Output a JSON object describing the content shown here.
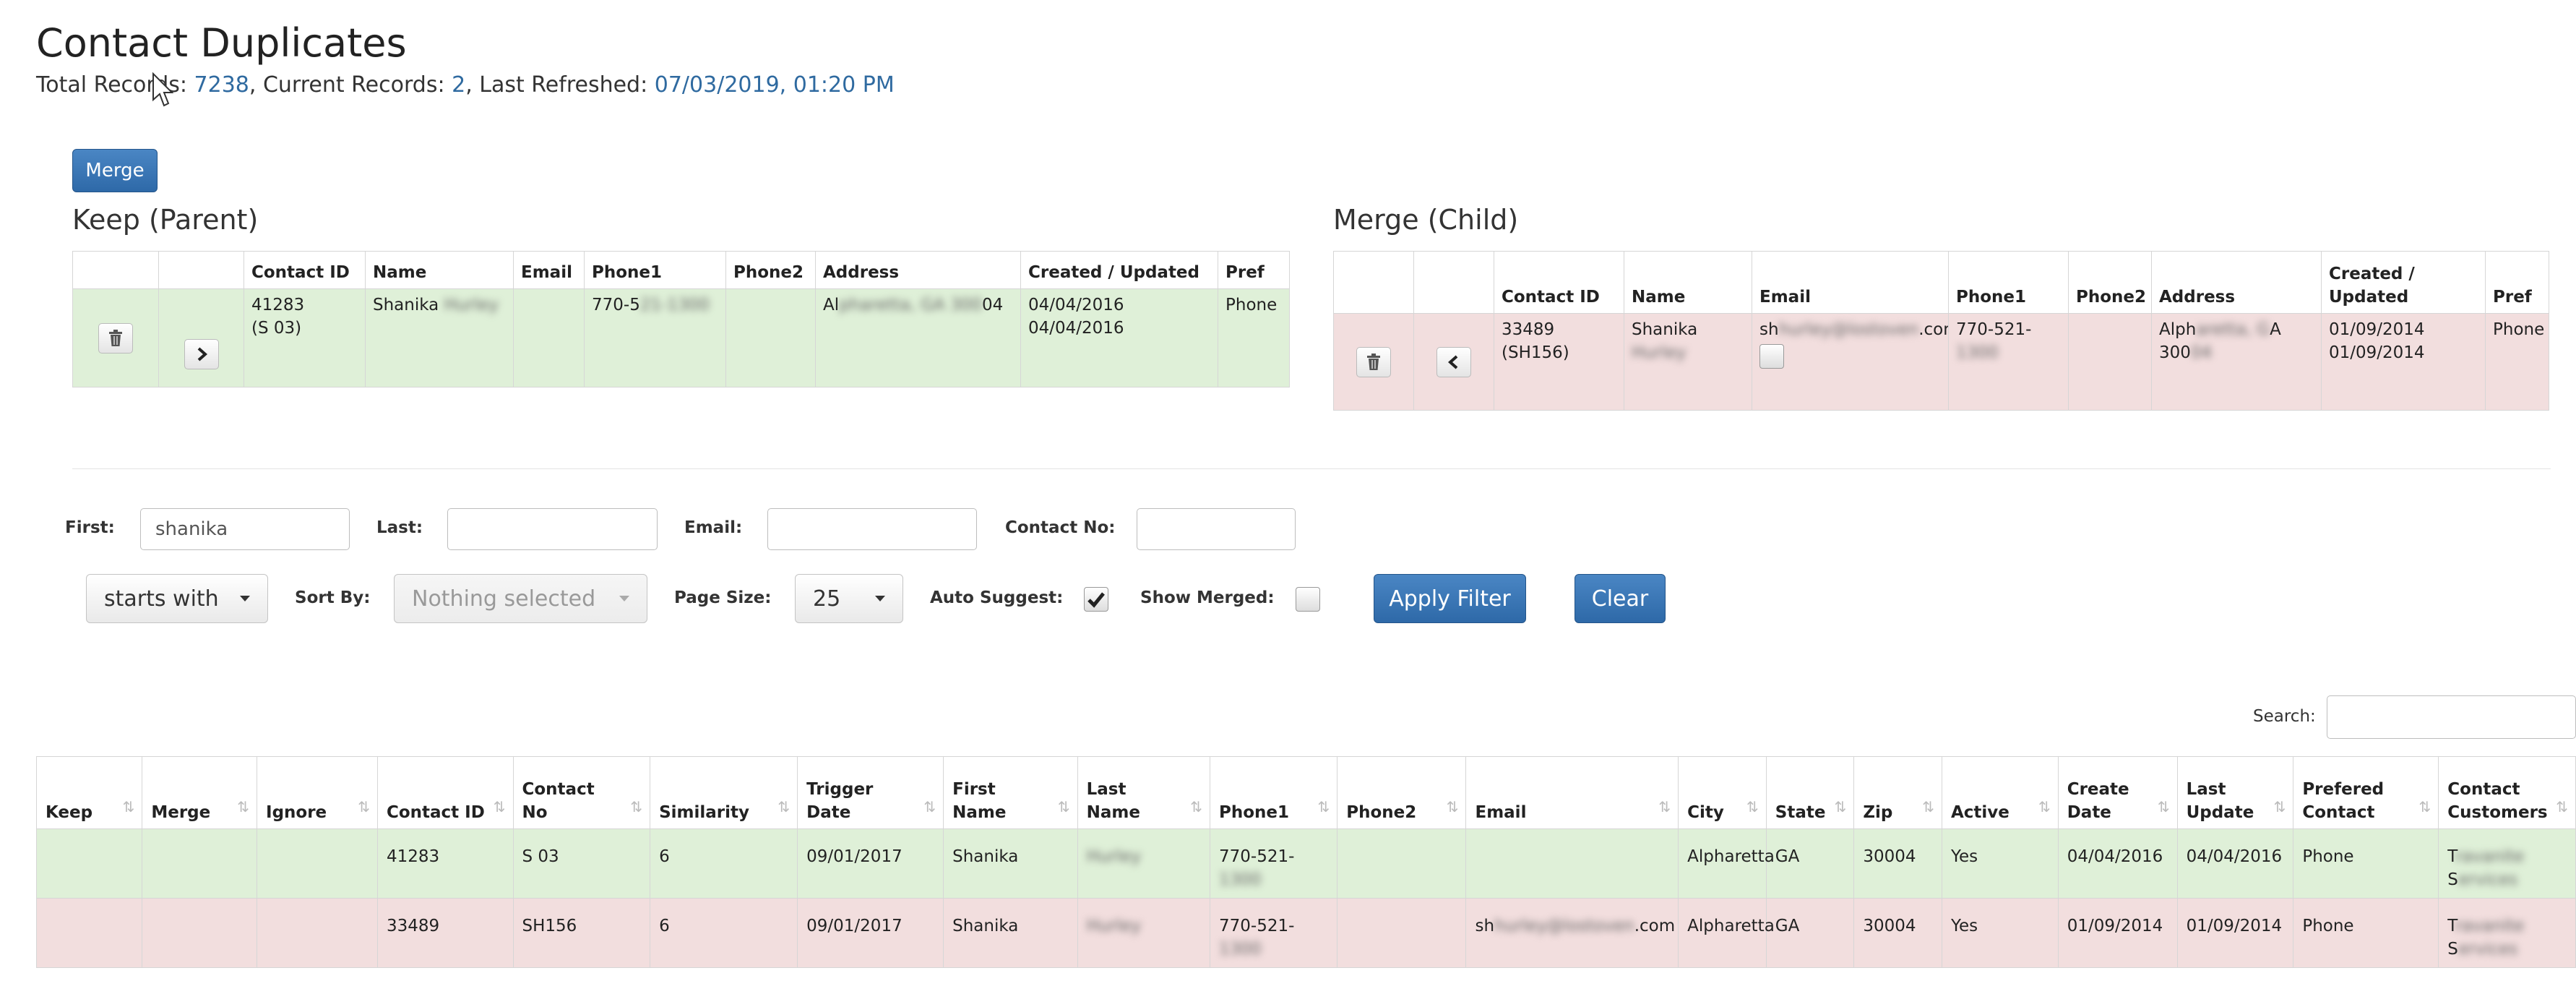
{
  "page": {
    "title": "Contact Duplicates",
    "summary": {
      "total_label": "Total Records: ",
      "total_value": "7238",
      "current_label": ", Current Records: ",
      "current_value": "2",
      "refreshed_label": ", Last Refreshed: ",
      "refreshed_value": "07/03/2019, 01:20 PM"
    }
  },
  "merge_button": "Merge",
  "keep_panel": {
    "title": "Keep (Parent)",
    "headers": [
      "",
      "",
      "Contact ID",
      "Name",
      "Email",
      "Phone1",
      "Phone2",
      "Address",
      "Created / Updated",
      "Pref"
    ],
    "row": {
      "contact_id": "41283",
      "contact_no": "(S 03)",
      "name_first": "Shanika",
      "name_last": "Hurley",
      "email": "",
      "phone1_visible": "770-5",
      "phone1_hidden": "21-1300",
      "phone2": "",
      "address_visible_a": "Al",
      "address_hidden": "pharetta, GA 300",
      "address_visible_b": "04",
      "created": "04/04/2016",
      "updated": "04/04/2016",
      "pref": "Phone"
    }
  },
  "merge_panel": {
    "title": "Merge (Child)",
    "headers": [
      "",
      "",
      "Contact ID",
      "Name",
      "Email",
      "Phone1",
      "Phone2",
      "Address",
      "Created / Updated",
      "Pref"
    ],
    "row": {
      "contact_id": "33489",
      "contact_no": "(SH156)",
      "name_first": "Shanika",
      "name_last": "Hurley",
      "email_visible_a": "sh",
      "email_hidden": "hurley@lostoven",
      "email_visible_b": ".com",
      "phone1_visible": "770-521-",
      "phone1_hidden": "1300",
      "phone2": "",
      "address_visible_a": "Alph",
      "address_hidden": "aretta, G",
      "address_visible_b": "A",
      "address_line2_visible": "300",
      "address_line2_hidden": "04",
      "created": "01/09/2014",
      "updated": "01/09/2014",
      "pref": "Phone"
    }
  },
  "filters": {
    "first_label": "First:",
    "first_value": "shanika",
    "last_label": "Last:",
    "last_value": "",
    "email_label": "Email:",
    "email_value": "",
    "contact_no_label": "Contact No:",
    "contact_no_value": "",
    "match_mode": "starts with",
    "sort_by_label": "Sort By:",
    "sort_by_value": "Nothing selected",
    "page_size_label": "Page Size:",
    "page_size_value": "25",
    "auto_suggest_label": "Auto Suggest:",
    "auto_suggest_checked": true,
    "show_merged_label": "Show Merged:",
    "show_merged_checked": false,
    "apply_label": "Apply Filter",
    "clear_label": "Clear"
  },
  "search": {
    "label": "Search:",
    "value": ""
  },
  "grid": {
    "headers": [
      "Keep",
      "Merge",
      "Ignore",
      "Contact ID",
      "Contact No",
      "Similarity",
      "Trigger Date",
      "First Name",
      "Last Name",
      "Phone1",
      "Phone2",
      "Email",
      "City",
      "State",
      "Zip",
      "Active",
      "Create Date",
      "Last Update",
      "Prefered Contact",
      "Contact Customers"
    ],
    "rows": [
      {
        "contact_id": "41283",
        "contact_no": "S 03",
        "similarity": "6",
        "trigger_date": "09/01/2017",
        "first_name": "Shanika",
        "last_name": "Hurley",
        "phone1_visible": "770-521-",
        "phone1_hidden": "1300",
        "phone2": "",
        "email_visible_a": "",
        "email_hidden": "",
        "email_visible_b": "",
        "city": "Alpharetta",
        "state": "GA",
        "zip": "30004",
        "active": "Yes",
        "create_date": "04/04/2016",
        "last_update": "04/04/2016",
        "prefered_contact": "Phone",
        "customers_a": "T",
        "customers_a_hidden": "ravanite",
        "customers_b": "S",
        "customers_b_hidden": "ervices"
      },
      {
        "contact_id": "33489",
        "contact_no": "SH156",
        "similarity": "6",
        "trigger_date": "09/01/2017",
        "first_name": "Shanika",
        "last_name": "Hurley",
        "phone1_visible": "770-521-",
        "phone1_hidden": "1300",
        "phone2": "",
        "email_visible_a": "sh",
        "email_hidden": "hurley@lostoven",
        "email_visible_b": ".com",
        "city": "Alpharetta",
        "state": "GA",
        "zip": "30004",
        "active": "Yes",
        "create_date": "01/09/2014",
        "last_update": "01/09/2014",
        "prefered_contact": "Phone",
        "customers_a": "T",
        "customers_a_hidden": "ravanite",
        "customers_b": "S",
        "customers_b_hidden": "ervices"
      }
    ]
  },
  "colors": {
    "link_value": "#2f6aa0",
    "keep_row": "#dff0d8",
    "merge_row": "#f2dede",
    "primary_button": "#337ab7"
  }
}
